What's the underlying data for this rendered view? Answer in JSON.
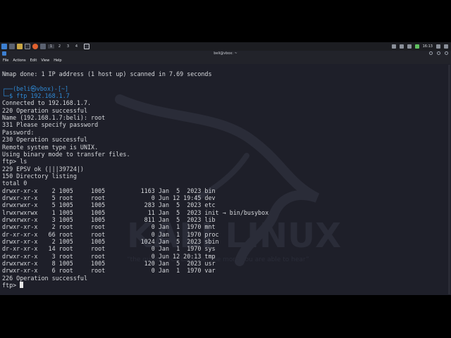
{
  "taskbar": {
    "workspaces": [
      "1",
      "2",
      "3",
      "4"
    ],
    "clock": "16:13"
  },
  "window": {
    "title": "beli@vbox: ~"
  },
  "menu": [
    "File",
    "Actions",
    "Edit",
    "View",
    "Help"
  ],
  "terminal": {
    "lines": [
      {
        "text": "Nmap done: 1 IP address (1 host up) scanned in 7.69 seconds",
        "kind": "out"
      },
      {
        "text": "",
        "kind": "out"
      },
      {
        "text": "┌──(beli㉿vbox)-[~]",
        "kind": "prompt1"
      },
      {
        "text": "└─$ ftp 192.168.1.7",
        "kind": "prompt2"
      },
      {
        "text": "Connected to 192.168.1.7.",
        "kind": "out"
      },
      {
        "text": "220 Operation successful",
        "kind": "out"
      },
      {
        "text": "Name (192.168.1.7:beli): root",
        "kind": "out"
      },
      {
        "text": "331 Please specify password",
        "kind": "out"
      },
      {
        "text": "Password:",
        "kind": "out"
      },
      {
        "text": "230 Operation successful",
        "kind": "out"
      },
      {
        "text": "Remote system type is UNIX.",
        "kind": "out"
      },
      {
        "text": "Using binary mode to transfer files.",
        "kind": "out"
      },
      {
        "text": "ftp> ls",
        "kind": "out"
      },
      {
        "text": "229 EPSV ok (|||39724|)",
        "kind": "out"
      },
      {
        "text": "150 Directory listing",
        "kind": "out"
      },
      {
        "text": "total 0",
        "kind": "out"
      },
      {
        "text": "drwxr-xr-x    2 1005     1005          1163 Jan  5  2023 bin",
        "kind": "out"
      },
      {
        "text": "drwxr-xr-x    5 root     root             0 Jun 12 19:45 dev",
        "kind": "out"
      },
      {
        "text": "drwxrwxr-x    5 1005     1005           283 Jan  5  2023 etc",
        "kind": "out"
      },
      {
        "text": "lrwxrwxrwx    1 1005     1005            11 Jan  5  2023 init → bin/busybox",
        "kind": "out"
      },
      {
        "text": "drwxrwxr-x    3 1005     1005           811 Jan  5  2023 lib",
        "kind": "out"
      },
      {
        "text": "drwxr-xr-x    2 root     root             0 Jan  1  1970 mnt",
        "kind": "out"
      },
      {
        "text": "dr-xr-xr-x   66 root     root             0 Jan  1  1970 proc",
        "kind": "out"
      },
      {
        "text": "drwxr-xr-x    2 1005     1005          1024 Jan  5  2023 sbin",
        "kind": "out"
      },
      {
        "text": "dr-xr-xr-x   14 root     root             0 Jan  1  1970 sys",
        "kind": "out"
      },
      {
        "text": "drwxr-xr-x    3 root     root             0 Jun 12 20:13 tmp",
        "kind": "out"
      },
      {
        "text": "drwxrwxr-x    8 1005     1005           120 Jan  5  2023 usr",
        "kind": "out"
      },
      {
        "text": "drwxr-xr-x    6 root     root             0 Jan  1  1970 var",
        "kind": "out"
      },
      {
        "text": "226 Operation successful",
        "kind": "out"
      },
      {
        "text": "ftp> ",
        "kind": "cursorline"
      }
    ]
  },
  "watermark": {
    "text": "KALI LINUX",
    "slogan": "“the quieter you become, the more you are able to hear”"
  },
  "colors": {
    "terminal_bg": "#1e1f29",
    "prompt_blue": "#2f8ad6",
    "text": "#d6d8dc"
  }
}
